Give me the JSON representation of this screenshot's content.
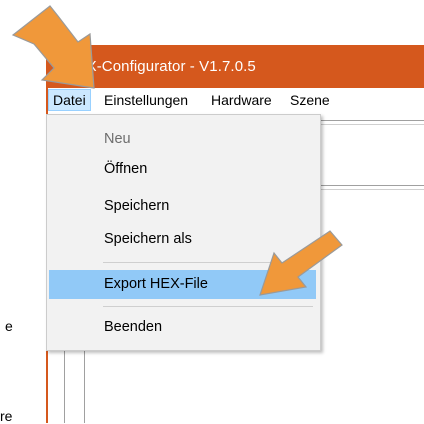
{
  "window": {
    "title": "MX-Configurator - V1.7.0.5"
  },
  "menu_bar": {
    "items": [
      {
        "label": "Datei"
      },
      {
        "label": "Einstellungen"
      },
      {
        "label": "Hardware"
      },
      {
        "label": "Szene"
      }
    ]
  },
  "file_menu": {
    "items": [
      {
        "label": "Neu",
        "enabled": false
      },
      {
        "label": "Öffnen",
        "enabled": true
      },
      {
        "label": "Speichern",
        "enabled": true
      },
      {
        "label": "Speichern als",
        "enabled": true
      },
      {
        "label": "Export HEX-File",
        "enabled": true,
        "highlighted": true
      },
      {
        "label": "Beenden",
        "enabled": true
      }
    ]
  },
  "background_text": {
    "fragment_1": "e",
    "fragment_2": "re"
  },
  "annotations": {
    "arrow_color": "#f0983a",
    "arrow_icon_1": "arrow-pointer-icon",
    "arrow_icon_2": "arrow-pointer-icon"
  }
}
